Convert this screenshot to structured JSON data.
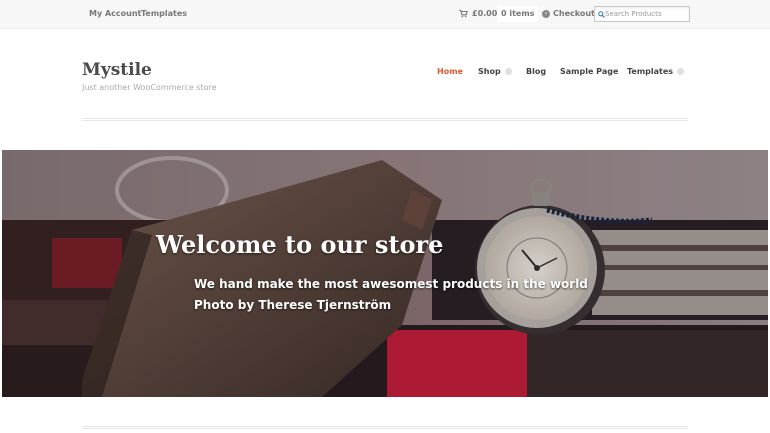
{
  "topbar": {
    "my_account": "My Account",
    "templates": "Templates",
    "cart_total": "£0.00",
    "cart_items": "0 items",
    "checkout": "Checkout",
    "search_placeholder": "Search Products"
  },
  "header": {
    "site_title": "Mystile",
    "site_description": "Just another WooCommerce store"
  },
  "nav": {
    "home": "Home",
    "shop": "Shop",
    "blog": "Blog",
    "sample_page": "Sample Page",
    "templates": "Templates"
  },
  "hero": {
    "title": "Welcome to our store",
    "subtitle_line1": "We hand make the most awesomest products in the world",
    "subtitle_line2": "Photo by Therese Tjernström"
  },
  "colors": {
    "accent": "#e2582e",
    "text": "#444444",
    "topbar_bg": "#f7f7f7"
  },
  "icons": {
    "cart": "cart-icon",
    "checkout": "checkout-icon",
    "search": "search-icon",
    "dropdown": "dropdown-indicator-icon"
  }
}
